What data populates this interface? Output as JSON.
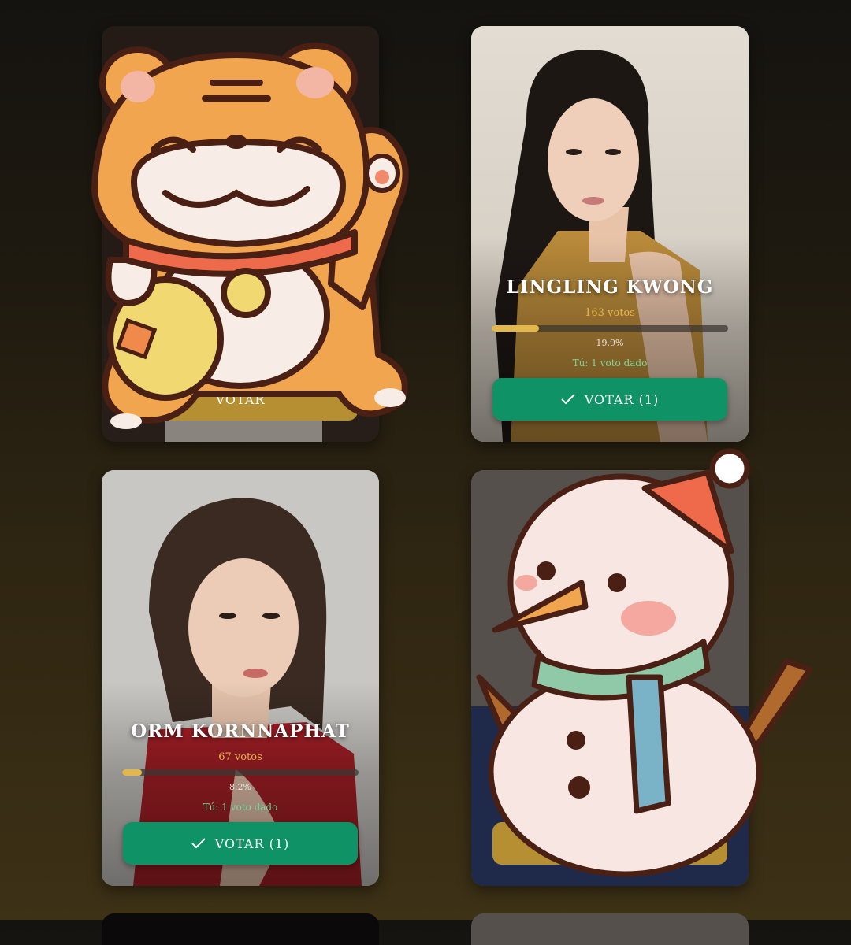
{
  "cards": [
    {
      "name": "",
      "votes": "",
      "percent": "",
      "given": "",
      "button": "VOTAR",
      "sticker": "tiger-sticker"
    },
    {
      "name": "LINGLING KWONG",
      "votes": "163 votos",
      "percent": "19.9%",
      "progress": 0.199,
      "given": "Tú: 1 voto dado",
      "button": "VOTAR (1)"
    },
    {
      "name": "ORM KORNNAPHAT",
      "votes": "67 votos",
      "percent": "8.2%",
      "progress": 0.082,
      "given": "Tú: 1 voto dado",
      "button": "VOTAR (1)"
    },
    {
      "name": "",
      "votes": "",
      "percent": "",
      "given": "",
      "button": "",
      "sticker": "snowman-sticker"
    }
  ],
  "colors": {
    "accent_green": "#0f9366",
    "gold": "#e2b84a",
    "votes_text": "#e8b64a",
    "given_text": "#7ed39a"
  }
}
